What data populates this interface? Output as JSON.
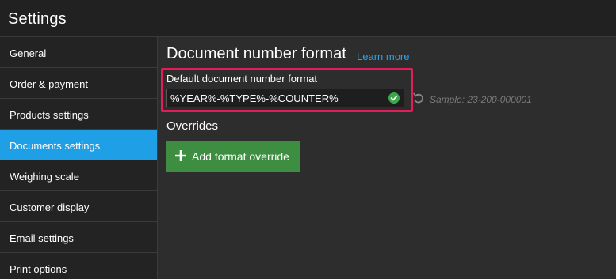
{
  "window": {
    "title": "Settings"
  },
  "sidebar": {
    "items": [
      {
        "label": "General"
      },
      {
        "label": "Order & payment"
      },
      {
        "label": "Products settings"
      },
      {
        "label": "Documents settings",
        "active": true
      },
      {
        "label": "Weighing scale"
      },
      {
        "label": "Customer display"
      },
      {
        "label": "Email settings"
      },
      {
        "label": "Print options"
      }
    ]
  },
  "main": {
    "heading": "Document number format",
    "learn_more": "Learn more",
    "default_format": {
      "label": "Default document number format",
      "value": "%YEAR%-%TYPE%-%COUNTER%",
      "valid_icon": "check-circle-icon",
      "reset_icon": "undo-icon",
      "sample": "Sample: 23-200-000001"
    },
    "overrides": {
      "title": "Overrides",
      "add_button_label": "Add format override",
      "add_icon": "plus-icon"
    }
  },
  "colors": {
    "accent": "#1e9fe6",
    "link": "#2aa3ea",
    "highlight": "#e21d5a",
    "success": "#3e8e41",
    "check": "#3aa84a"
  }
}
